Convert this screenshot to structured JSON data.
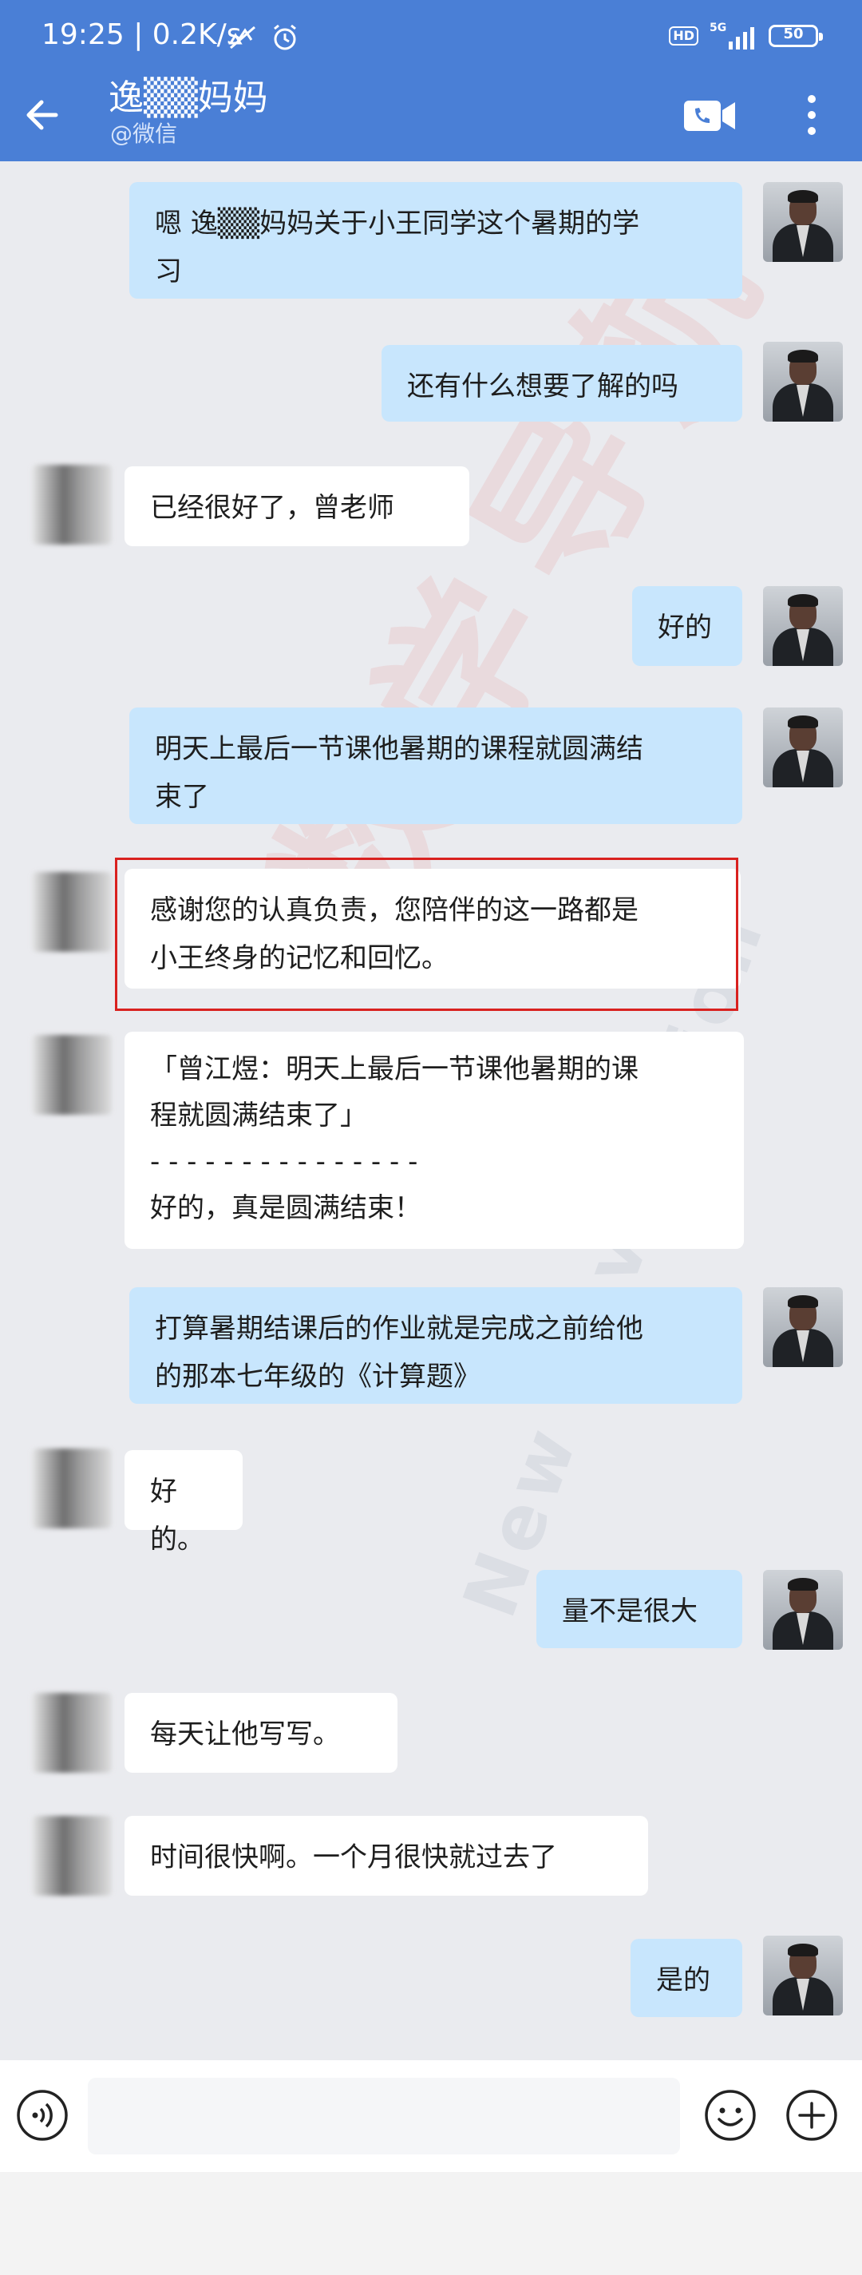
{
  "status_bar": {
    "time": "19:25",
    "speed": "| 0.2K/s",
    "hd": "HD",
    "network": "5G",
    "battery": "50"
  },
  "header": {
    "contact_name": "逸▒▒妈妈",
    "contact_source": "@微信"
  },
  "messages": [
    {
      "side": "me",
      "text": "嗯 逸▒▒妈妈关于小王同学这个暑期的学\n习"
    },
    {
      "side": "me",
      "text": "还有什么想要了解的吗"
    },
    {
      "side": "them",
      "text": "已经很好了，曾老师"
    },
    {
      "side": "me",
      "text": "好的"
    },
    {
      "side": "me",
      "text": "明天上最后一节课他暑期的课程就圆满结\n束了"
    },
    {
      "side": "them",
      "text": "感谢您的认真负责，您陪伴的这一路都是\n小王终身的记忆和回忆。"
    },
    {
      "side": "them",
      "text": "「曾江煜：明天上最后一节课他暑期的课\n程就圆满结束了」\n- - - - - - - - - - - - - - -\n好的，真是圆满结束！"
    },
    {
      "side": "me",
      "text": "打算暑期结课后的作业就是完成之前给他\n的那本七年级的《计算题》"
    },
    {
      "side": "them",
      "text": "好的。"
    },
    {
      "side": "me",
      "text": "量不是很大"
    },
    {
      "side": "them",
      "text": "每天让他写写。"
    },
    {
      "side": "them",
      "text": "时间很快啊。一个月很快就过去了"
    },
    {
      "side": "me",
      "text": "是的"
    }
  ],
  "watermarks": {
    "red": "数学导航",
    "gray": "New Navigation"
  },
  "input": {
    "placeholder": ""
  },
  "colors": {
    "header": "#4a7fd6",
    "my_bubble": "#c8e6fd",
    "their_bubble": "#ffffff",
    "highlight_box": "#d9211f",
    "background": "#eaebef"
  }
}
